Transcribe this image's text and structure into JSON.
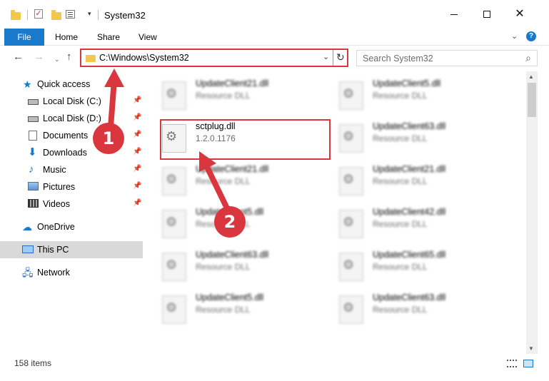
{
  "window": {
    "title": "System32",
    "qa_dropdown": "▾",
    "minimize_label": "",
    "maximize_label": "",
    "close_label": "✕"
  },
  "ribbon": {
    "tabs": [
      "File",
      "Home",
      "Share",
      "View"
    ],
    "expand_icon": "chevron-down-icon",
    "help_label": "?"
  },
  "address": {
    "path": "C:\\Windows\\System32",
    "refresh_glyph": "↻",
    "dropdown_glyph": "⌄"
  },
  "search": {
    "placeholder": "Search System32",
    "icon": "search-icon"
  },
  "nav": {
    "back": "←",
    "forward": "→",
    "recent": "⌄",
    "up": "↑"
  },
  "sidebar": {
    "quick_access": "Quick access",
    "items": [
      {
        "label": "Local Disk (C:)",
        "icon": "drive-icon"
      },
      {
        "label": "Local Disk (D:)",
        "icon": "drive-icon"
      },
      {
        "label": "Documents",
        "icon": "document-icon"
      },
      {
        "label": "Downloads",
        "icon": "download-icon"
      },
      {
        "label": "Music",
        "icon": "music-icon"
      },
      {
        "label": "Pictures",
        "icon": "pictures-icon"
      },
      {
        "label": "Videos",
        "icon": "videos-icon"
      }
    ],
    "onedrive": "OneDrive",
    "this_pc": "This PC",
    "network": "Network",
    "pin_glyph": "📌"
  },
  "files": {
    "left": [
      {
        "name": "UpdateClient21.dll",
        "desc": "Resource DLL"
      },
      {
        "name": "sctplug.dll",
        "desc": "1.2.0.1176"
      },
      {
        "name": "UpdateClient21.dll",
        "desc": "Resource DLL"
      },
      {
        "name": "UpdateClient5.dll",
        "desc": "Resource DLL"
      },
      {
        "name": "UpdateClient63.dll",
        "desc": "Resource DLL"
      },
      {
        "name": "UpdateClient5.dll",
        "desc": "Resource DLL"
      }
    ],
    "right": [
      {
        "name": "UpdateClient5.dll",
        "desc": "Resource DLL"
      },
      {
        "name": "UpdateClient63.dll",
        "desc": "Resource DLL"
      },
      {
        "name": "UpdateClient21.dll",
        "desc": "Resource DLL"
      },
      {
        "name": "UpdateClient42.dll",
        "desc": "Resource DLL"
      },
      {
        "name": "UpdateClient65.dll",
        "desc": "Resource DLL"
      },
      {
        "name": "UpdateClient63.dll",
        "desc": "Resource DLL"
      }
    ]
  },
  "status": {
    "item_count": "158 items"
  },
  "annotations": {
    "step1": "1",
    "step2": "2",
    "color": "#d9363e"
  },
  "colors": {
    "accent": "#1979ca",
    "highlight": "#d9363e"
  }
}
